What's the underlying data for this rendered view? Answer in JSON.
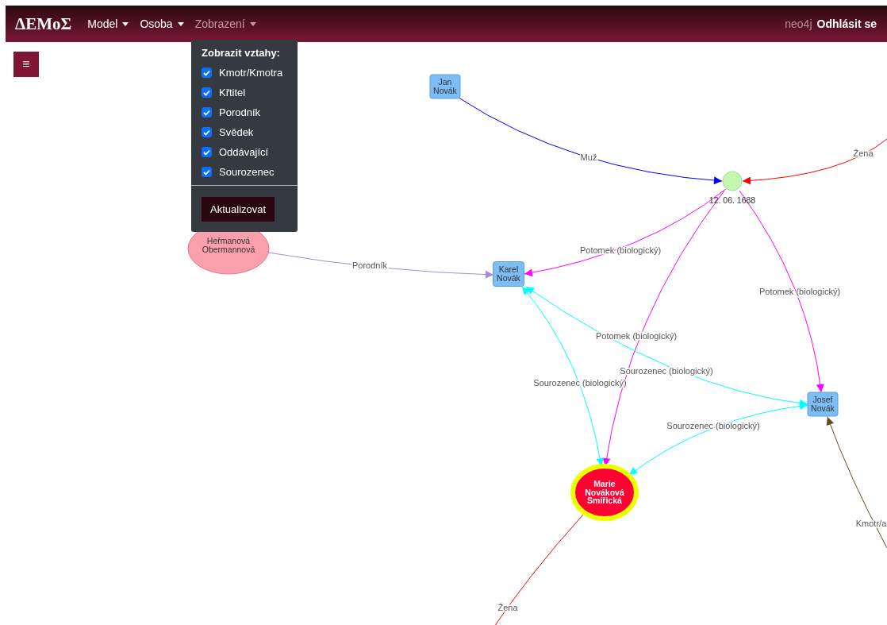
{
  "navbar": {
    "brand": "ΔΕΜοΣ",
    "menus": [
      {
        "label": "Model",
        "open": false
      },
      {
        "label": "Osoba",
        "open": false
      },
      {
        "label": "Zobrazení",
        "open": true
      }
    ],
    "user": "neo4j",
    "logout": "Odhlásit se"
  },
  "sidebar_toggle": {
    "label": "≡"
  },
  "dropdown": {
    "heading": "Zobrazit vztahy:",
    "options": [
      {
        "label": "Kmotr/Kmotra",
        "checked": true
      },
      {
        "label": "Křtitel",
        "checked": true
      },
      {
        "label": "Porodník",
        "checked": true
      },
      {
        "label": "Svědek",
        "checked": true
      },
      {
        "label": "Oddávající",
        "checked": true
      },
      {
        "label": "Sourozenec",
        "checked": true
      }
    ],
    "button": "Aktualizovat"
  },
  "graph": {
    "nodes": [
      {
        "kind": "box",
        "lines": [
          "Jan",
          "Novák"
        ],
        "color": "#7dbdf5",
        "highlighted": false
      },
      {
        "kind": "circle",
        "lines": [
          "12. 06. 1688"
        ],
        "color": "#c4f7b0",
        "highlighted": false
      },
      {
        "kind": "box",
        "lines": [
          "Karel",
          "Novák"
        ],
        "color": "#7dbdf5",
        "highlighted": false
      },
      {
        "kind": "box",
        "lines": [
          "Josef",
          "Novák"
        ],
        "color": "#7dbdf5",
        "highlighted": false
      },
      {
        "kind": "ellipse",
        "lines": [
          "Marie",
          "Nováková",
          "Smiřická"
        ],
        "color": "#ff0033",
        "highlighted": true
      },
      {
        "kind": "ellipse",
        "lines": [
          "Heřmanová",
          "Obermannová"
        ],
        "color": "#f9a0ac",
        "highlighted": false
      }
    ],
    "edges": [
      {
        "label": "Muž",
        "color": "#0000ff",
        "arrow_start": false
      },
      {
        "label": "Žena",
        "color": "#ff0000",
        "arrow_start": false
      },
      {
        "label": "Potomek (biologický)",
        "color": "#ff00ff",
        "arrow_start": false
      },
      {
        "label": "Potomek (biologický)",
        "color": "#ff00ff",
        "arrow_start": false
      },
      {
        "label": "Potomek (biologický)",
        "color": "#ff00ff",
        "arrow_start": false
      },
      {
        "label": "Porodník",
        "color": "#a88be0",
        "arrow_start": false
      },
      {
        "label": "Sourozenec (biologický)",
        "color": "#00ffff",
        "arrow_start": true
      },
      {
        "label": "Sourozenec (biologický)",
        "color": "#00ffff",
        "arrow_start": true
      },
      {
        "label": "Sourozenec (biologický)",
        "color": "#00ffff",
        "arrow_start": true
      },
      {
        "label": "Kmotr/a",
        "color": "#6b4a1a",
        "arrow_start": false
      },
      {
        "label": "Žena",
        "color": "#ff0000",
        "arrow_start": false
      }
    ]
  }
}
